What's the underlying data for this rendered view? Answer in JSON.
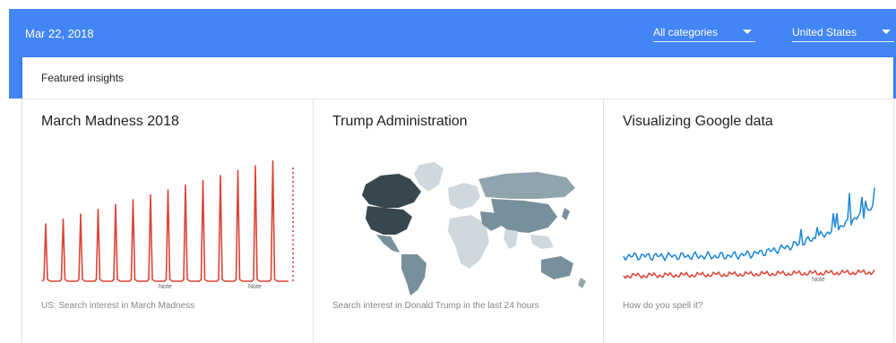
{
  "header": {
    "date": "Mar 22, 2018",
    "category_filter": "All categories",
    "geo_filter": "United States"
  },
  "section_title": "Featured insights",
  "cards": [
    {
      "title": "March Madness 2018",
      "caption": "US: Search interest in March Madness",
      "annotations": [
        "Note",
        "Note"
      ]
    },
    {
      "title": "Trump Administration",
      "caption": "Search interest in Donald Trump in the last 24 hours"
    },
    {
      "title": "Visualizing Google data",
      "caption": "How do you spell it?",
      "annotations": [
        "Note"
      ]
    }
  ],
  "colors": {
    "header_bg": "#4285f4",
    "red_series": "#db4437",
    "blue_series": "#1a86d8",
    "map_dark": "#37474f",
    "map_mid": "#78909c",
    "map_light": "#cfd8dc"
  }
}
